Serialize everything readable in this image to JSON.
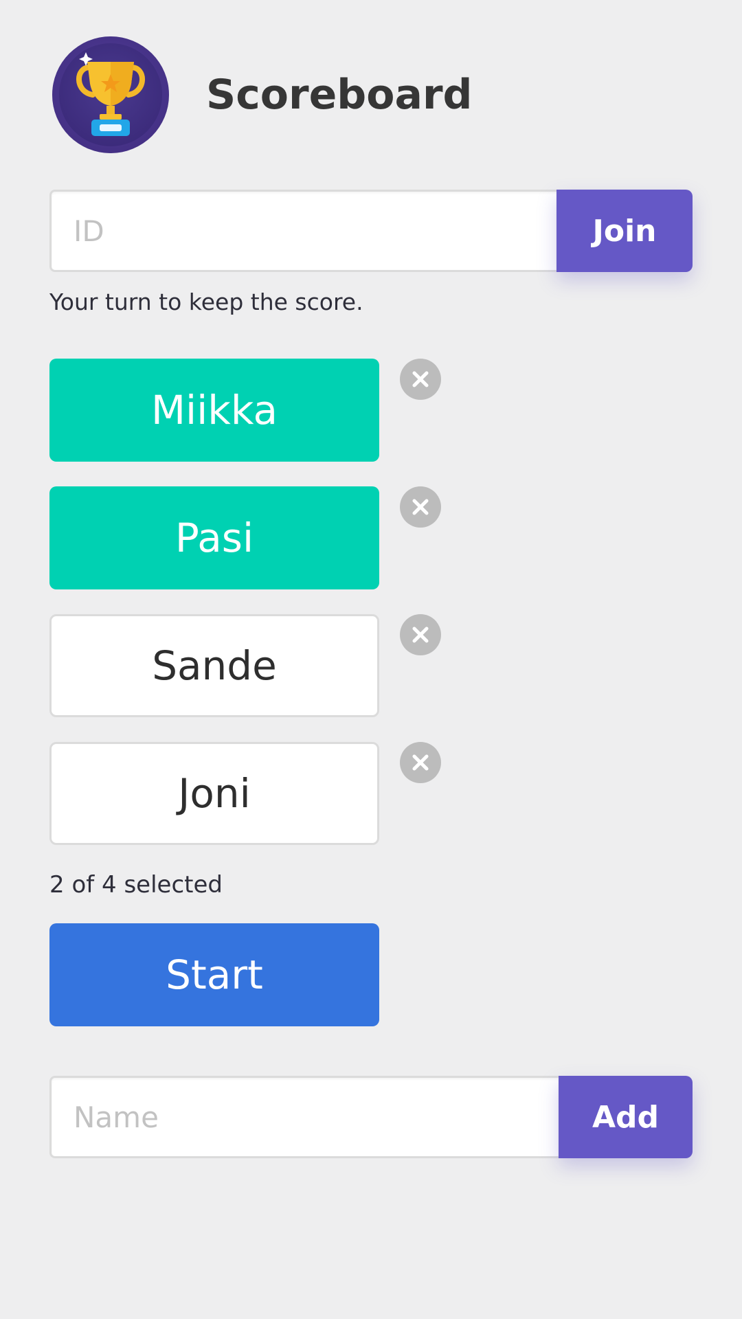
{
  "app": {
    "title": "Scoreboard",
    "logo_icon": "trophy-icon"
  },
  "join": {
    "placeholder": "ID",
    "value": "",
    "button_label": "Join"
  },
  "status": {
    "help_text": "Your turn to keep the score."
  },
  "players": [
    {
      "name": "Miikka",
      "selected": true
    },
    {
      "name": "Pasi",
      "selected": true
    },
    {
      "name": "Sande",
      "selected": false
    },
    {
      "name": "Joni",
      "selected": false
    }
  ],
  "selection": {
    "summary": "2 of 4 selected"
  },
  "start": {
    "label": "Start"
  },
  "add_player": {
    "placeholder": "Name",
    "value": "",
    "button_label": "Add"
  },
  "colors": {
    "background": "#eeeeef",
    "primary": "#6558c6",
    "selected": "#00d1b2",
    "start": "#3574de",
    "remove": "#bcbcbc"
  }
}
